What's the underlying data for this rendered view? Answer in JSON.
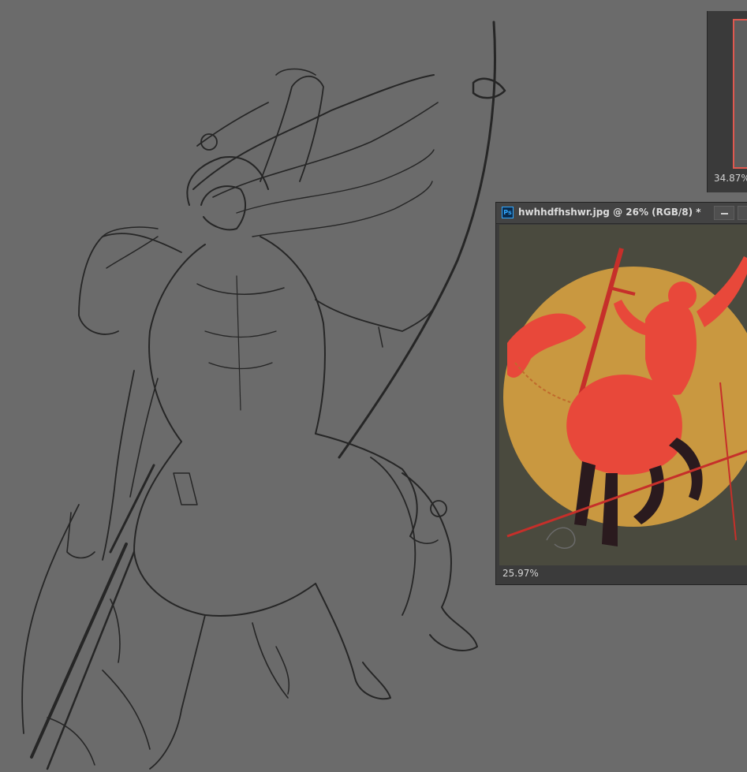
{
  "canvas": {
    "background": "#6b6b6b"
  },
  "back_window": {
    "zoom_label": "34.87%",
    "border_color": "#e0584f"
  },
  "front_window": {
    "app_icon": "Ps",
    "title": "hwhhdfhshwr.jpg @ 26% (RGB/8) *",
    "zoom_label": "25.97%",
    "colors": {
      "background": "#4a4a3e",
      "sun": "#c99840",
      "figure": "#e8483a",
      "legs": "#2a1a1e"
    }
  },
  "icons": [
    "minimize-icon",
    "maximize-icon",
    "photoshop-icon"
  ]
}
